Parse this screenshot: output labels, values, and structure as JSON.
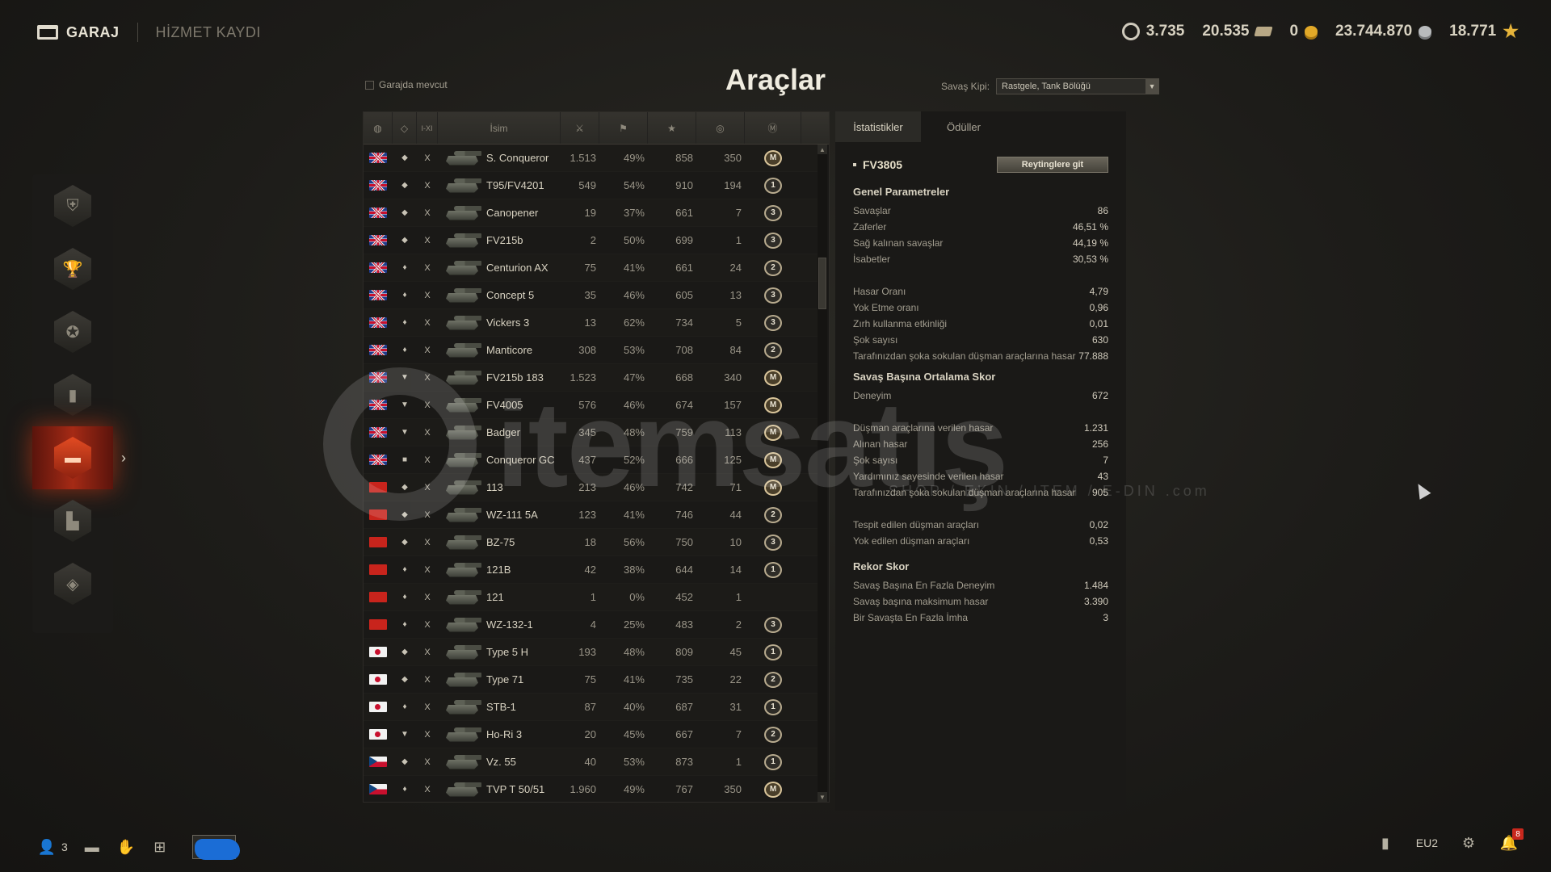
{
  "nav": {
    "garage": "GARAJ",
    "service_record": "HİZMET KAYDI"
  },
  "currencies": {
    "free_xp": "3.735",
    "bonds": "20.535",
    "gold": "0",
    "credits": "23.744.870",
    "crystal": "18.771"
  },
  "title": "Araçlar",
  "filter": {
    "in_garage": "Garajda mevcut"
  },
  "battle_mode": {
    "label": "Savaş Kipi:",
    "value": "Rastgele, Tank Bölüğü"
  },
  "table": {
    "headers": {
      "tier": "I-XI",
      "name": "İsim"
    },
    "rows": [
      {
        "flag": "uk",
        "cls": "◆",
        "tier": "X",
        "name": "S. Conqueror",
        "battles": "1.513",
        "win": "49%",
        "xp": "858",
        "mark": "350",
        "mastery": "M"
      },
      {
        "flag": "uk",
        "cls": "◆",
        "tier": "X",
        "name": "T95/FV4201",
        "battles": "549",
        "win": "54%",
        "xp": "910",
        "mark": "194",
        "mastery": "1"
      },
      {
        "flag": "uk",
        "cls": "◆",
        "tier": "X",
        "name": "Canopener",
        "battles": "19",
        "win": "37%",
        "xp": "661",
        "mark": "7",
        "mastery": "3"
      },
      {
        "flag": "uk",
        "cls": "◆",
        "tier": "X",
        "name": "FV215b",
        "battles": "2",
        "win": "50%",
        "xp": "699",
        "mark": "1",
        "mastery": "3"
      },
      {
        "flag": "uk",
        "cls": "♦",
        "tier": "X",
        "name": "Centurion AX",
        "battles": "75",
        "win": "41%",
        "xp": "661",
        "mark": "24",
        "mastery": "2"
      },
      {
        "flag": "uk",
        "cls": "♦",
        "tier": "X",
        "name": "Concept 5",
        "battles": "35",
        "win": "46%",
        "xp": "605",
        "mark": "13",
        "mastery": "3"
      },
      {
        "flag": "uk",
        "cls": "♦",
        "tier": "X",
        "name": "Vickers 3",
        "battles": "13",
        "win": "62%",
        "xp": "734",
        "mark": "5",
        "mastery": "3"
      },
      {
        "flag": "uk",
        "cls": "♦",
        "tier": "X",
        "name": "Manticore",
        "battles": "308",
        "win": "53%",
        "xp": "708",
        "mark": "84",
        "mastery": "2"
      },
      {
        "flag": "uk",
        "cls": "▼",
        "tier": "X",
        "name": "FV215b 183",
        "battles": "1.523",
        "win": "47%",
        "xp": "668",
        "mark": "340",
        "mastery": "M"
      },
      {
        "flag": "uk",
        "cls": "▼",
        "tier": "X",
        "name": "FV4005",
        "battles": "576",
        "win": "46%",
        "xp": "674",
        "mark": "157",
        "mastery": "M"
      },
      {
        "flag": "uk",
        "cls": "▼",
        "tier": "X",
        "name": "Badger",
        "battles": "345",
        "win": "48%",
        "xp": "759",
        "mark": "113",
        "mastery": "M"
      },
      {
        "flag": "uk",
        "cls": "■",
        "tier": "X",
        "name": "Conqueror GC",
        "battles": "437",
        "win": "52%",
        "xp": "666",
        "mark": "125",
        "mastery": "M"
      },
      {
        "flag": "cn",
        "cls": "◆",
        "tier": "X",
        "name": "113",
        "battles": "213",
        "win": "46%",
        "xp": "742",
        "mark": "71",
        "mastery": "M"
      },
      {
        "flag": "cn",
        "cls": "◆",
        "tier": "X",
        "name": "WZ-111 5A",
        "battles": "123",
        "win": "41%",
        "xp": "746",
        "mark": "44",
        "mastery": "2"
      },
      {
        "flag": "cn",
        "cls": "◆",
        "tier": "X",
        "name": "BZ-75",
        "battles": "18",
        "win": "56%",
        "xp": "750",
        "mark": "10",
        "mastery": "3"
      },
      {
        "flag": "cn",
        "cls": "♦",
        "tier": "X",
        "name": "121B",
        "battles": "42",
        "win": "38%",
        "xp": "644",
        "mark": "14",
        "mastery": "1"
      },
      {
        "flag": "cn",
        "cls": "♦",
        "tier": "X",
        "name": "121",
        "battles": "1",
        "win": "0%",
        "xp": "452",
        "mark": "1",
        "mastery": ""
      },
      {
        "flag": "cn",
        "cls": "♦",
        "tier": "X",
        "name": "WZ-132-1",
        "battles": "4",
        "win": "25%",
        "xp": "483",
        "mark": "2",
        "mastery": "3"
      },
      {
        "flag": "jp",
        "cls": "◆",
        "tier": "X",
        "name": "Type 5 H",
        "battles": "193",
        "win": "48%",
        "xp": "809",
        "mark": "45",
        "mastery": "1"
      },
      {
        "flag": "jp",
        "cls": "◆",
        "tier": "X",
        "name": "Type 71",
        "battles": "75",
        "win": "41%",
        "xp": "735",
        "mark": "22",
        "mastery": "2"
      },
      {
        "flag": "jp",
        "cls": "♦",
        "tier": "X",
        "name": "STB-1",
        "battles": "87",
        "win": "40%",
        "xp": "687",
        "mark": "31",
        "mastery": "1"
      },
      {
        "flag": "jp",
        "cls": "▼",
        "tier": "X",
        "name": "Ho-Ri 3",
        "battles": "20",
        "win": "45%",
        "xp": "667",
        "mark": "7",
        "mastery": "2"
      },
      {
        "flag": "cz",
        "cls": "◆",
        "tier": "X",
        "name": "Vz. 55",
        "battles": "40",
        "win": "53%",
        "xp": "873",
        "mark": "1",
        "mastery": "1"
      },
      {
        "flag": "cz",
        "cls": "♦",
        "tier": "X",
        "name": "TVP T 50/51",
        "battles": "1.960",
        "win": "49%",
        "xp": "767",
        "mark": "350",
        "mastery": "M"
      }
    ]
  },
  "panel": {
    "tabs": [
      "İstatistikler",
      "Ödüller"
    ],
    "vehicle": "FV3805",
    "rating_button": "Reytinglere git",
    "general_title": "Genel Parametreler",
    "general": [
      {
        "label": "Savaşlar",
        "value": "86"
      },
      {
        "label": "Zaferler",
        "value": "46,51 %"
      },
      {
        "label": "Sağ kalınan savaşlar",
        "value": "44,19 %"
      },
      {
        "label": "İsabetler",
        "value": "30,53 %"
      }
    ],
    "general2": [
      {
        "label": "Hasar Oranı",
        "value": "4,79"
      },
      {
        "label": "Yok Etme oranı",
        "value": "0,96"
      },
      {
        "label": "Zırh kullanma etkinliği",
        "value": "0,01"
      },
      {
        "label": "Şok sayısı",
        "value": "630"
      },
      {
        "label": "Tarafınızdan şoka sokulan düşman araçlarına hasar",
        "value": "77.888"
      }
    ],
    "avg_title": "Savaş Başına Ortalama Skor",
    "avg1": [
      {
        "label": "Deneyim",
        "value": "672"
      }
    ],
    "avg2": [
      {
        "label": "Düşman araçlarına verilen hasar",
        "value": "1.231"
      },
      {
        "label": "Alınan hasar",
        "value": "256"
      },
      {
        "label": "Şok sayısı",
        "value": "7"
      },
      {
        "label": "Yardımınız sayesinde verilen hasar",
        "value": "43"
      },
      {
        "label": "Tarafınızdan şoka sokulan düşman araçlarına hasar",
        "value": "905"
      }
    ],
    "avg3": [
      {
        "label": "Tespit edilen düşman araçları",
        "value": "0,02"
      },
      {
        "label": "Yok edilen düşman araçları",
        "value": "0,53"
      }
    ],
    "record_title": "Rekor Skor",
    "record": [
      {
        "label": "Savaş Başına En Fazla Deneyim",
        "value": "1.484"
      },
      {
        "label": "Savaş başına maksimum hasar",
        "value": "3.390"
      },
      {
        "label": "Bir Savaşta En Fazla İmha",
        "value": "3"
      }
    ]
  },
  "watermark": {
    "text": "itemsatış",
    "sub": "SHOP / EKIN / ITEM / E-DIN .com"
  },
  "bottom": {
    "friends_count": "3",
    "server": "EU2",
    "notifications": "8"
  }
}
